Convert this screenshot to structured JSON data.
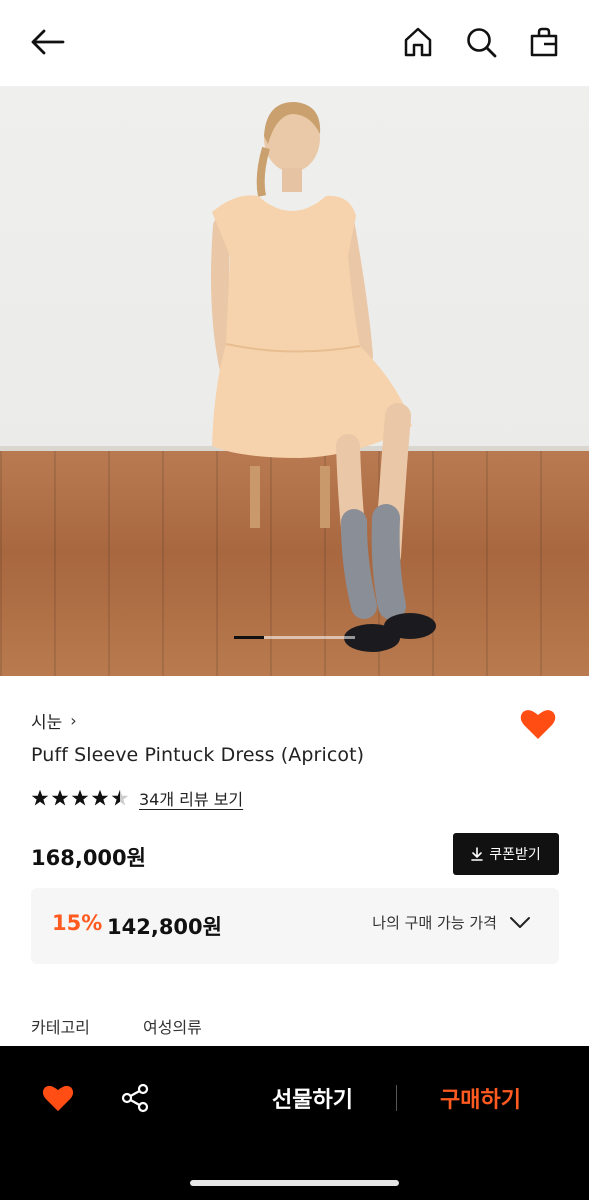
{
  "header": {
    "back_icon": "arrow-left-icon",
    "home_icon": "home-icon",
    "search_icon": "search-icon",
    "bag_icon": "shopping-bag-icon"
  },
  "product": {
    "brand": "시눈",
    "brand_chevron": "›",
    "title": "Puff Sleeve Pintuck Dress (Apricot)",
    "rating": 4.5,
    "review_link": "34개 리뷰 보기",
    "price": "168,000원",
    "coupon_label": "쿠폰받기",
    "discount_percent": "15%",
    "sale_price": "142,800원",
    "my_price_label": "나의 구매 가능 가격",
    "category_label": "카테고리",
    "category_value": "여성의류"
  },
  "carousel": {
    "active_index": 1
  },
  "bottom_bar": {
    "gift_label": "선물하기",
    "buy_label": "구매하기"
  },
  "colors": {
    "accent": "#ff5a1f",
    "black": "#111111",
    "heart": "#ff4d14"
  }
}
